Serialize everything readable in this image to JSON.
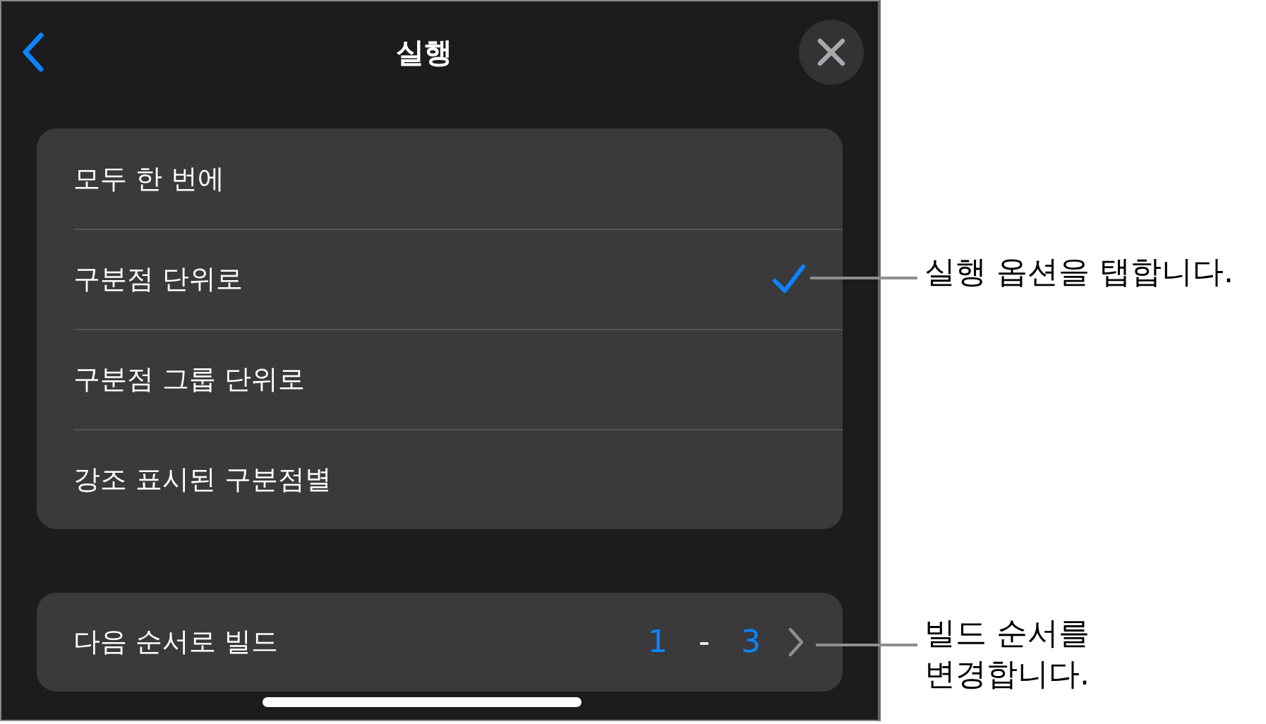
{
  "header": {
    "title": "실행"
  },
  "options": [
    {
      "label": "모두 한 번에",
      "selected": false
    },
    {
      "label": "구분점 단위로",
      "selected": true
    },
    {
      "label": "구분점 그룹 단위로",
      "selected": false
    },
    {
      "label": "강조 표시된 구분점별",
      "selected": false
    }
  ],
  "build_order": {
    "label": "다음 순서로 빌드",
    "from": "1",
    "separator": "-",
    "to": "3"
  },
  "callouts": [
    "실행 옵션을 탭합니다.",
    "빌드 순서를\n변경합니다."
  ]
}
